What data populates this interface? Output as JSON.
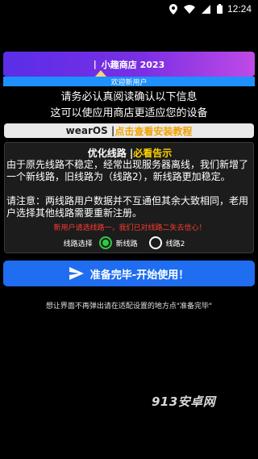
{
  "status_bar": {
    "time": "12:24",
    "icons": [
      "location-icon",
      "wifi-icon",
      "signal-icon",
      "battery-icon"
    ]
  },
  "header": {
    "title": "小趣商店 2023",
    "separator": "|",
    "subtitle": "欢迎新用户"
  },
  "notice": {
    "line1": "请务必认真阅读确认以下信息",
    "line2": "这可以使应用商店更适应您的设备"
  },
  "wearos": {
    "label": "wearOS |",
    "link": "点击查看安装教程"
  },
  "panel": {
    "title": "优化线路 |",
    "title_warn": "必看告示",
    "paragraph1": "由于原先线路不稳定，经常出现服务器离线，我们新增了一个新线路，旧线路为（线路2），新线路更加稳定。",
    "paragraph2": "请注意：两线路用户数据并不互通但其余大致相同，老用户选择其他线路需要重新注册。",
    "red_note": "新用户请选线路一，我们已对线路二失去信心！",
    "route_label": "线路选择",
    "option1": "新线路",
    "option2": "线路2",
    "selected": "新线路"
  },
  "primary_button": {
    "label": "准备完毕-开始使用！"
  },
  "footnote": "想让界面不再弹出请在适配设置的地方点\"准备完毕\"",
  "watermark": "913安卓网",
  "colors": {
    "title_gradient_start": "#5a2ee8",
    "title_gradient_end": "#c04ae6",
    "subtitle_bar": "#1e90ff",
    "link_orange": "#f2a100",
    "warn_yellow": "#ffd400",
    "red_note": "#ff3b2f",
    "radio_selected": "#2ecc40",
    "primary_button": "#1f6df0"
  }
}
